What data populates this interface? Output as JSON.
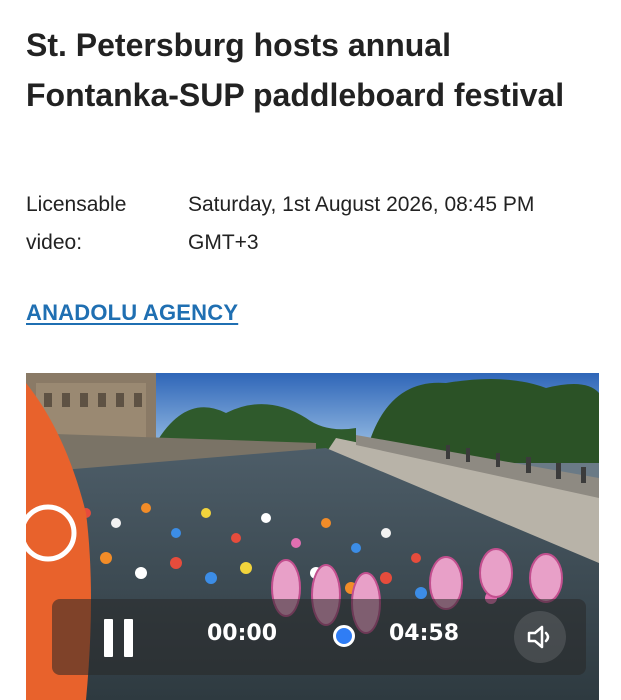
{
  "article": {
    "headline": "St. Petersburg hosts annual Fontanka-SUP paddleboard festival",
    "meta_label": "Licensable video:",
    "datetime": "Saturday, 1st August 2026, 08:45 PM GMT+3",
    "agency": "ANADOLU AGENCY"
  },
  "player": {
    "current_time": "00:00",
    "duration": "04:58",
    "state_icon": "pause-icon",
    "volume_icon": "speaker-icon",
    "accent_color": "#2f7df5"
  }
}
